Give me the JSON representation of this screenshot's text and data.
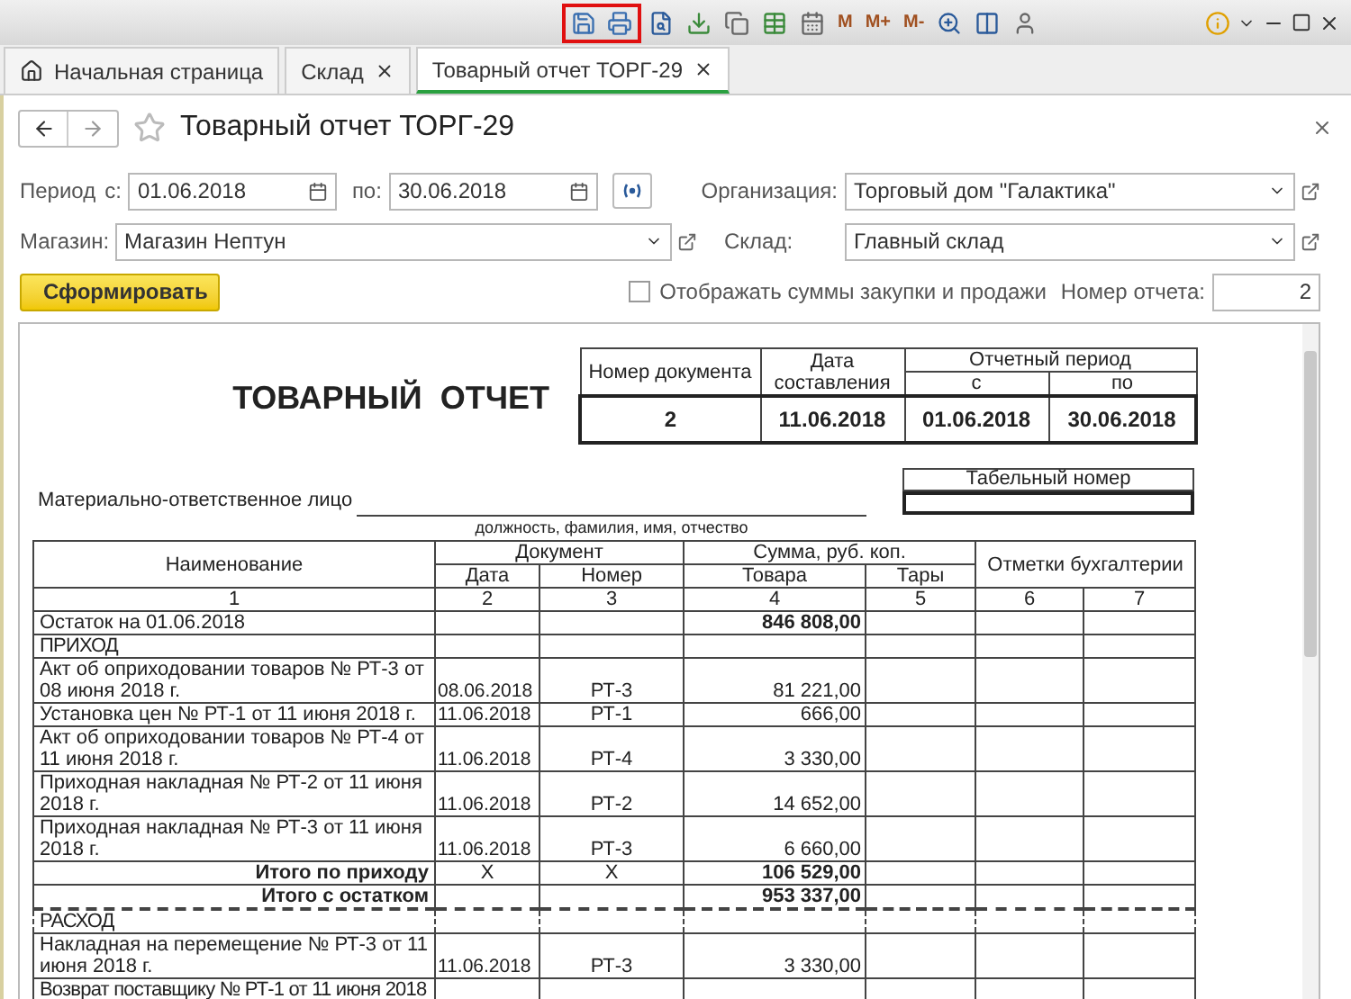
{
  "toolbar": {
    "memory_buttons": [
      "M",
      "M+",
      "M-"
    ]
  },
  "tabs": [
    {
      "label": "Начальная страница",
      "kind": "home",
      "closable": false,
      "selected": false
    },
    {
      "label": "Склад",
      "kind": "page",
      "closable": true,
      "selected": false
    },
    {
      "label": "Товарный отчет ТОРГ-29",
      "kind": "page",
      "closable": true,
      "selected": true
    }
  ],
  "form": {
    "title": "Товарный отчет ТОРГ-29",
    "favorite": false,
    "period_label": "Период",
    "from_label": "с:",
    "from_value": "01.06.2018",
    "to_label": "по:",
    "to_value": "30.06.2018",
    "organization_label": "Организация:",
    "organization_value": "Торговый дом \"Галактика\"",
    "shop_label": "Магазин:",
    "shop_value": "Магазин Нептун",
    "warehouse_label": "Склад:",
    "warehouse_value": "Главный склад",
    "generate_button": "Сформировать",
    "show_sums_label": "Отображать суммы закупки и продажи",
    "show_sums_checked": false,
    "report_number_label": "Номер отчета:",
    "report_number_value": "2"
  },
  "report": {
    "title": "ТОВАРНЫЙ  ОТЧЕТ",
    "header_table": {
      "doc_number_label": "Номер документа",
      "date_label": "Дата составления",
      "period_label": "Отчетный период",
      "from_label": "с",
      "to_label": "по",
      "doc_number": "2",
      "date": "11.06.2018",
      "from": "01.06.2018",
      "to": "30.06.2018"
    },
    "personnel_number_label": "Табельный номер",
    "responsible_label": "Материально-ответственное лицо",
    "responsible_caption": "должность, фамилия, имя, отчество",
    "table": {
      "name_header": "Наименование",
      "document_header": "Документ",
      "date_header": "Дата",
      "number_header": "Номер",
      "sum_header": "Сумма, руб. коп.",
      "goods_header": "Товара",
      "tare_header": "Тары",
      "marks_header": "Отметки бухгалтерии",
      "column_numbers": [
        "1",
        "2",
        "3",
        "4",
        "5",
        "6",
        "7"
      ],
      "rows": [
        {
          "kind": "balance",
          "name": "Остаток на 01.06.2018",
          "goods": "846 808,00",
          "page_break": false
        },
        {
          "kind": "section",
          "name": "ПРИХОД",
          "page_break": false
        },
        {
          "kind": "item",
          "name": "Акт об оприходовании товаров № РТ-3 от 08 июня 2018 г.",
          "date": "08.06.2018",
          "number": "РТ-3",
          "goods": "81 221,00",
          "page_break": false
        },
        {
          "kind": "item",
          "name": "Установка цен № РТ-1 от 11 июня 2018 г.",
          "date": "11.06.2018",
          "number": "РТ-1",
          "goods": "666,00",
          "page_break": false
        },
        {
          "kind": "item",
          "name": "Акт об оприходовании товаров № РТ-4 от 11 июня 2018 г.",
          "date": "11.06.2018",
          "number": "РТ-4",
          "goods": "3 330,00",
          "page_break": false
        },
        {
          "kind": "item",
          "name": "Приходная накладная № РТ-2 от 11 июня 2018 г.",
          "date": "11.06.2018",
          "number": "РТ-2",
          "goods": "14 652,00",
          "page_break": false
        },
        {
          "kind": "item",
          "name": "Приходная накладная № РТ-3 от 11 июня 2018 г.",
          "date": "11.06.2018",
          "number": "РТ-3",
          "goods": "6 660,00",
          "page_break": false
        },
        {
          "kind": "total",
          "name": "Итого по приходу",
          "date": "X",
          "number": "X",
          "goods": "106 529,00",
          "page_break": false
        },
        {
          "kind": "grand_total",
          "name": "Итого с остатком",
          "goods": "953 337,00",
          "page_break": false
        },
        {
          "kind": "section",
          "name": "РАСХОД",
          "page_break": true
        },
        {
          "kind": "item",
          "name": "Накладная на перемещение № РТ-3 от 11 июня 2018 г.",
          "date": "11.06.2018",
          "number": "РТ-3",
          "goods": "3 330,00",
          "page_break": false
        },
        {
          "kind": "section",
          "name": "Возврат поставщику № РТ-1 от 11 июня 2018",
          "page_break": false
        }
      ]
    }
  }
}
